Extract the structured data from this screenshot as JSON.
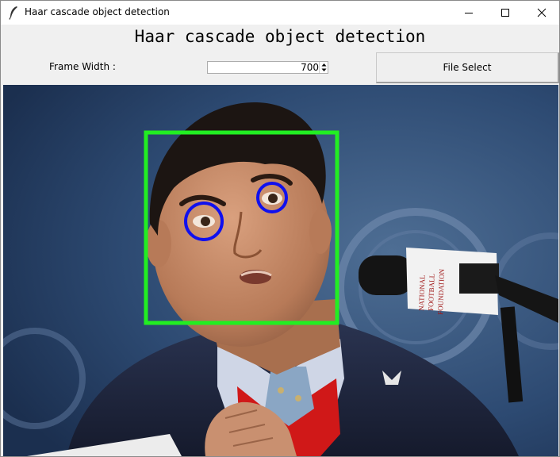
{
  "window": {
    "title": "Haar cascade object detection",
    "icon": "feather-icon"
  },
  "controls": {
    "minimize_icon": "minimize-icon",
    "maximize_icon": "maximize-icon",
    "close_icon": "close-icon"
  },
  "app": {
    "heading": "Haar cascade object detection"
  },
  "toolbar": {
    "frame_width_label": "Frame Width :",
    "frame_width_value": "700",
    "file_select_label": "File Select"
  },
  "image": {
    "microphone_text": "NATIONAL FOOTBALL FOUNDATION",
    "detections": [
      {
        "label": "face",
        "color": "#22ee22"
      },
      {
        "label": "eye",
        "color": "#1010ee"
      },
      {
        "label": "eye",
        "color": "#1010ee"
      }
    ]
  }
}
